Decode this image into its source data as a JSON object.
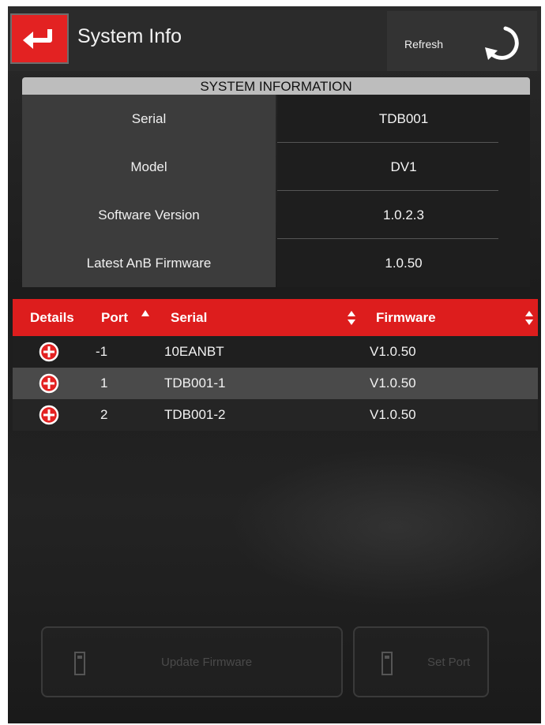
{
  "header": {
    "title": "System Info",
    "refresh_label": "Refresh",
    "back_icon": "return-arrow-icon",
    "refresh_icon": "refresh-icon"
  },
  "system_info": {
    "title": "SYSTEM INFORMATION",
    "rows": [
      {
        "label": "Serial",
        "value": "TDB001"
      },
      {
        "label": "Model",
        "value": "DV1"
      },
      {
        "label": "Software Version",
        "value": "1.0.2.3"
      },
      {
        "label": "Latest AnB Firmware",
        "value": "1.0.50"
      }
    ]
  },
  "ports_table": {
    "columns": {
      "details": "Details",
      "port": "Port",
      "serial": "Serial",
      "firmware": "Firmware"
    },
    "sort": {
      "column": "Port",
      "direction": "ascending"
    },
    "rows": [
      {
        "port": "-1",
        "serial": "10EANBT",
        "firmware": "V1.0.50"
      },
      {
        "port": "1",
        "serial": "TDB001-1",
        "firmware": "V1.0.50"
      },
      {
        "port": "2",
        "serial": "TDB001-2",
        "firmware": "V1.0.50"
      }
    ]
  },
  "actions": {
    "update_firmware_label": "Update Firmware",
    "second_button_label": "Set Port"
  },
  "colors": {
    "accent_red": "#e32222",
    "table_header_red": "#dd1d1d",
    "panel_gray": "#3c3c3c",
    "title_bar_gray": "#bdbdbd"
  }
}
